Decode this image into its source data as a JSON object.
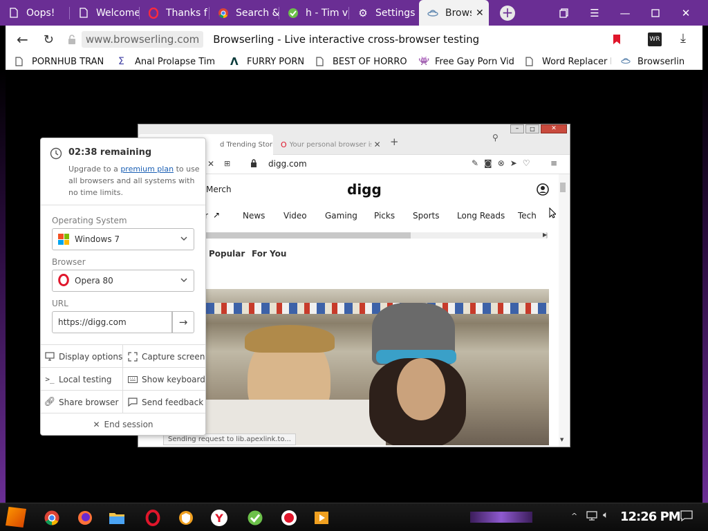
{
  "tabs": [
    {
      "title": "Oops!",
      "icon": "document-icon"
    },
    {
      "title": "Welcome",
      "icon": "document-icon"
    },
    {
      "title": "Thanks f",
      "icon": "opera-icon"
    },
    {
      "title": "Search &",
      "icon": "chrome-icon"
    },
    {
      "title": "h - Tim v",
      "icon": "check-leaf-icon"
    },
    {
      "title": "Settings",
      "icon": "gear-icon"
    },
    {
      "title": "Brows",
      "icon": "ufo-icon"
    }
  ],
  "addressbar": {
    "domain": "www.browserling.com",
    "page_title": "Browserling - Live interactive cross-browser testing"
  },
  "bookmarks": [
    {
      "label": "PORNHUB TRAN",
      "icon": "document-icon"
    },
    {
      "label": "Anal Prolapse Tim",
      "icon": "sigma-icon"
    },
    {
      "label": "FURRY PORN",
      "icon": "lambda-icon"
    },
    {
      "label": "BEST OF HORRO",
      "icon": "document-icon"
    },
    {
      "label": "Free Gay Porn Vid",
      "icon": "alien-icon"
    },
    {
      "label": "Word Replacer II",
      "icon": "document-icon"
    },
    {
      "label": "Browserlin",
      "icon": "ufo-icon"
    }
  ],
  "remote": {
    "tab1": "d Trending Stories",
    "tab2": "Your personal browser is al",
    "url": "digg.com",
    "merch": "Merch",
    "logo": "digg",
    "nav": [
      "r",
      "News",
      "Video",
      "Gaming",
      "Picks",
      "Sports",
      "Long Reads",
      "Tech"
    ],
    "subnav": [
      "Popular",
      "For You"
    ],
    "status": "Sending request to lib.apexlink.to..."
  },
  "panel": {
    "remaining": "02:38 remaining",
    "upgrade_pre": "Upgrade to a",
    "upgrade_link": "premium plan",
    "upgrade_post": "to use all browsers and all systems with no time limits.",
    "os_label": "Operating System",
    "os_value": "Windows 7",
    "browser_label": "Browser",
    "browser_value": "Opera 80",
    "url_label": "URL",
    "url_value": "https://digg.com",
    "buttons": [
      "Display options",
      "Capture screen",
      "Local testing",
      "Show keyboard",
      "Share browser",
      "Send feedback"
    ],
    "end": "End session"
  },
  "taskbar": {
    "clock": "12:26 PM"
  },
  "colors": {
    "tabbar": "#6a2e94",
    "link": "#1a5fb4",
    "opera_red": "#e0162b"
  }
}
